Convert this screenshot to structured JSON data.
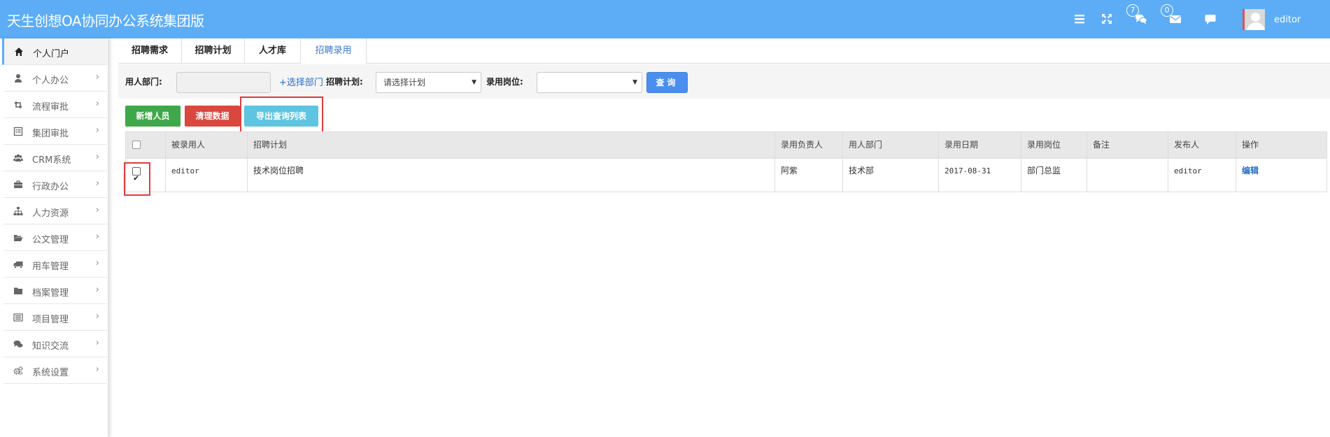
{
  "header": {
    "title": "天生创想OA协同办公系统集团版",
    "badges": {
      "chat": "7",
      "mail": "0"
    },
    "username": "editor",
    "icons": [
      "menu-icon",
      "fullscreen-icon",
      "chat-icon",
      "mail-icon",
      "message-icon"
    ]
  },
  "sidebar": {
    "items": [
      {
        "label": "个人门户",
        "icon": "home-icon",
        "active": true
      },
      {
        "label": "个人办公",
        "icon": "user-icon"
      },
      {
        "label": "流程审批",
        "icon": "retweet-icon"
      },
      {
        "label": "集团审批",
        "icon": "list-alt-icon"
      },
      {
        "label": "CRM系统",
        "icon": "users-icon"
      },
      {
        "label": "行政办公",
        "icon": "briefcase-icon"
      },
      {
        "label": "人力资源",
        "icon": "sitemap-icon"
      },
      {
        "label": "公文管理",
        "icon": "folder-open-icon"
      },
      {
        "label": "用车管理",
        "icon": "truck-icon"
      },
      {
        "label": "档案管理",
        "icon": "folder-icon"
      },
      {
        "label": "项目管理",
        "icon": "list-icon"
      },
      {
        "label": "知识交流",
        "icon": "comments-icon"
      },
      {
        "label": "系统设置",
        "icon": "cogs-icon"
      }
    ]
  },
  "tabs": [
    {
      "label": "招聘需求"
    },
    {
      "label": "招聘计划"
    },
    {
      "label": "人才库"
    },
    {
      "label": "招聘录用",
      "active": true
    }
  ],
  "filter": {
    "dept_label": "用人部门:",
    "dept_value": "",
    "select_dept_link": "+选择部门",
    "plan_label": "招聘计划:",
    "plan_value": "请选择计划",
    "position_label": "录用岗位:",
    "position_value": "",
    "query_button": "查询"
  },
  "actions": {
    "add": "新增人员",
    "clear": "清理数据",
    "export": "导出查询列表"
  },
  "table": {
    "headers": [
      "被录用人",
      "招聘计划",
      "录用负责人",
      "用人部门",
      "录用日期",
      "录用岗位",
      "备注",
      "发布人",
      "操作"
    ],
    "rows": [
      {
        "checked": true,
        "hired": "editor",
        "plan": "技术岗位招聘",
        "owner": "阿紫",
        "dept": "技术部",
        "date": "2017-08-31",
        "position": "部门总监",
        "note": "",
        "publisher": "editor",
        "action": "编辑"
      }
    ]
  },
  "colors": {
    "header_bg": "#5cadf6",
    "primary": "#4a8fef",
    "success": "#3ea84a",
    "danger": "#d9473f",
    "info": "#5ec4e0",
    "highlight_box": "#e03c3c"
  }
}
